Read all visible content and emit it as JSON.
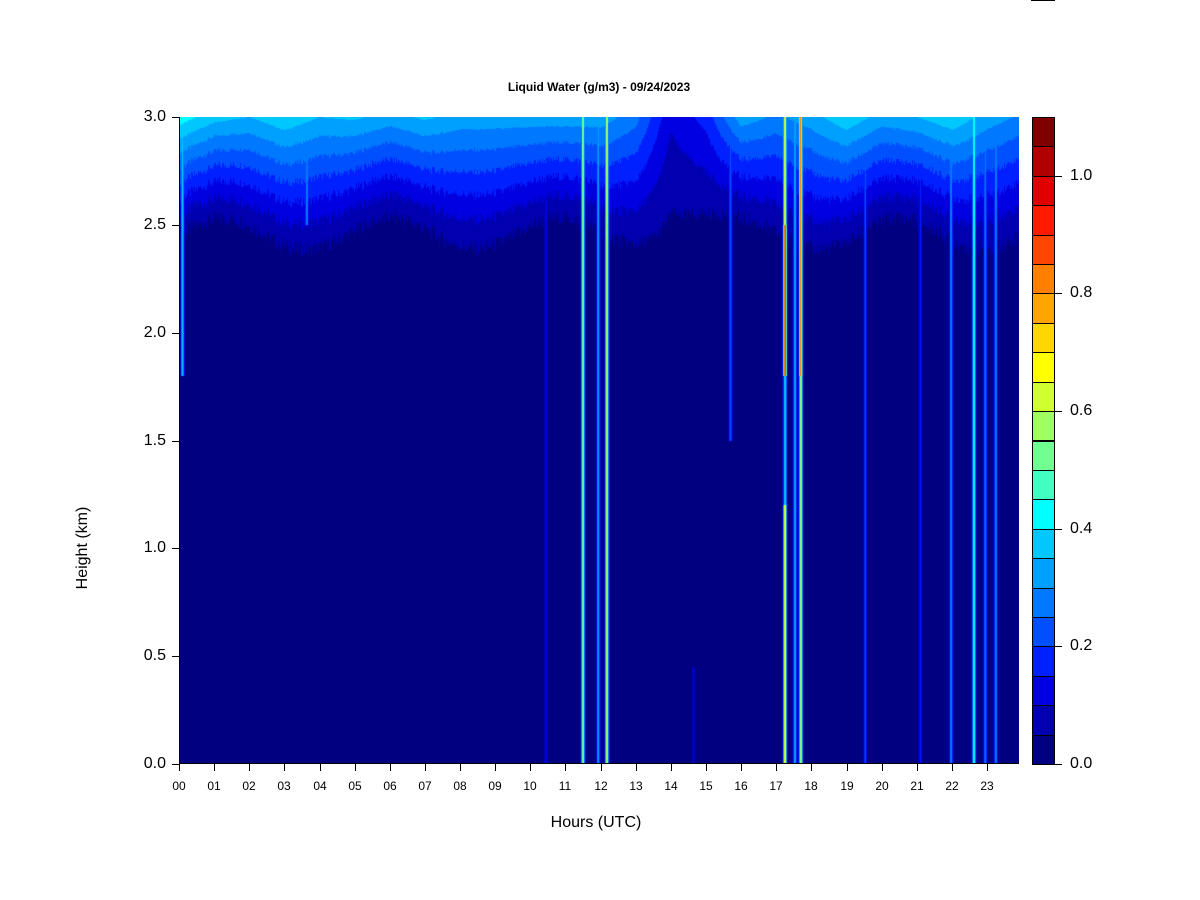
{
  "chart_data": {
    "type": "heatmap",
    "title": "Liquid Water (g/m3) - 09/24/2023",
    "xlabel": "Hours (UTC)",
    "ylabel": "Height (km)",
    "xlim": [
      0,
      23.91
    ],
    "ylim": [
      0,
      3.0
    ],
    "x_ticks": [
      0,
      1,
      2,
      3,
      4,
      5,
      6,
      7,
      8,
      9,
      10,
      11,
      12,
      13,
      14,
      15,
      16,
      17,
      18,
      19,
      20,
      21,
      22,
      23
    ],
    "x_tick_labels": [
      "00",
      "01",
      "02",
      "03",
      "04",
      "05",
      "06",
      "07",
      "08",
      "09",
      "10",
      "11",
      "12",
      "13",
      "14",
      "15",
      "16",
      "17",
      "18",
      "19",
      "20",
      "21",
      "22",
      "23"
    ],
    "y_ticks": [
      0,
      0.5,
      1.0,
      1.5,
      2.0,
      2.5,
      3.0
    ],
    "y_tick_labels": [
      "0.0",
      "0.5",
      "1.0",
      "1.5",
      "2.0",
      "2.5",
      "3.0"
    ],
    "colorbar": {
      "range": [
        0,
        1.1
      ],
      "level_step": 0.05,
      "ticks": [
        0,
        0.2,
        0.4,
        0.6,
        0.8,
        1.0
      ],
      "tick_labels": [
        "0.0",
        "0.2",
        "0.4",
        "0.6",
        "0.8",
        "1.0"
      ],
      "colors": [
        "#000080",
        "#0000B0",
        "#0000E0",
        "#0020FF",
        "#0050FF",
        "#0078FF",
        "#00A0FF",
        "#00C8FF",
        "#00FFFF",
        "#40FFC0",
        "#70FF90",
        "#A0FF60",
        "#D0FF30",
        "#FFFF00",
        "#FFD700",
        "#FFA500",
        "#FF7F00",
        "#FF4500",
        "#FF1A00",
        "#E00000",
        "#B00000",
        "#800000"
      ]
    },
    "top_layer_value_by_hour": [
      0.4,
      0.34,
      0.32,
      0.36,
      0.32,
      0.33,
      0.3,
      0.33,
      0.3,
      0.3,
      0.3,
      0.3,
      0.3,
      0.24,
      0.08,
      0.14,
      0.3,
      0.26,
      0.3,
      0.36,
      0.3,
      0.32,
      0.36,
      0.3,
      0.26
    ],
    "layer_base_km": 2.4,
    "streaks": [
      {
        "hour": 0.1,
        "value": 0.36,
        "zmin": 1.8,
        "zmax": 3.0
      },
      {
        "hour": 3.64,
        "value": 0.3,
        "zmin": 2.5,
        "zmax": 3.0
      },
      {
        "hour": 10.45,
        "value": 0.15,
        "zmin": 0.0,
        "zmax": 3.0
      },
      {
        "hour": 11.5,
        "value": 0.58,
        "zmin": 0.0,
        "zmax": 3.0
      },
      {
        "hour": 11.93,
        "value": 0.32,
        "zmin": 0.0,
        "zmax": 3.0
      },
      {
        "hour": 12.18,
        "value": 0.62,
        "zmin": 0.0,
        "zmax": 3.0
      },
      {
        "hour": 14.65,
        "value": 0.12,
        "zmin": 0.0,
        "zmax": 0.45
      },
      {
        "hour": 15.7,
        "value": 0.22,
        "zmin": 1.5,
        "zmax": 3.0
      },
      {
        "hour": 17.25,
        "value": 0.7,
        "zmin": 0.0,
        "zmax": 1.2
      },
      {
        "hour": 17.25,
        "value": 0.42,
        "zmin": 1.2,
        "zmax": 1.8
      },
      {
        "hour": 17.25,
        "value": 0.92,
        "zmin": 1.8,
        "zmax": 2.5
      },
      {
        "hour": 17.25,
        "value": 0.68,
        "zmin": 2.5,
        "zmax": 3.0
      },
      {
        "hour": 17.53,
        "value": 0.36,
        "zmin": 0.0,
        "zmax": 3.0
      },
      {
        "hour": 17.7,
        "value": 0.62,
        "zmin": 0.0,
        "zmax": 1.8
      },
      {
        "hour": 17.7,
        "value": 0.86,
        "zmin": 1.8,
        "zmax": 3.0
      },
      {
        "hour": 19.53,
        "value": 0.22,
        "zmin": 0.0,
        "zmax": 3.0
      },
      {
        "hour": 21.1,
        "value": 0.18,
        "zmin": 0.0,
        "zmax": 3.0
      },
      {
        "hour": 21.98,
        "value": 0.3,
        "zmin": 0.0,
        "zmax": 3.0
      },
      {
        "hour": 22.63,
        "value": 0.45,
        "zmin": 0.0,
        "zmax": 3.0
      },
      {
        "hour": 22.95,
        "value": 0.3,
        "zmin": 0.0,
        "zmax": 3.0
      },
      {
        "hour": 23.25,
        "value": 0.3,
        "zmin": 0.0,
        "zmax": 3.0
      }
    ]
  }
}
